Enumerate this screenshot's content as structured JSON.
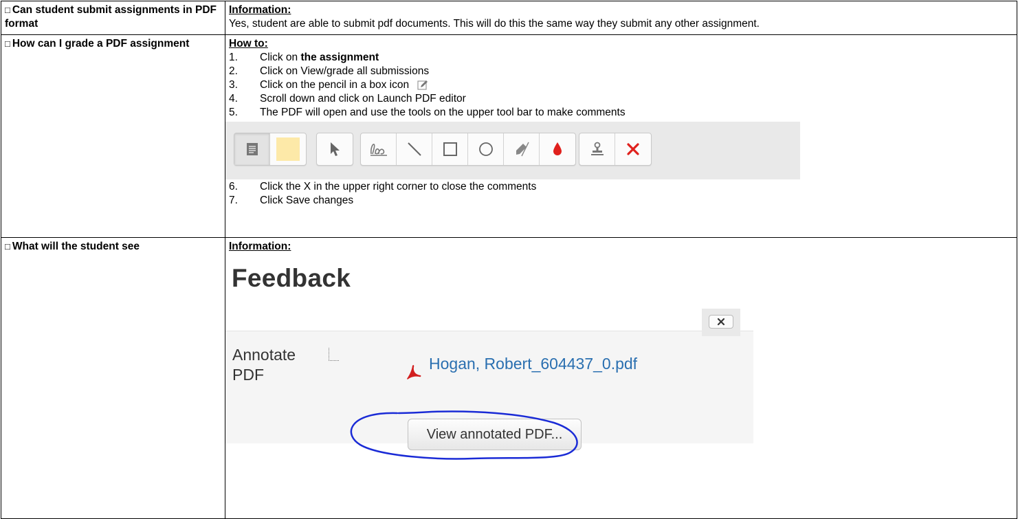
{
  "rows": [
    {
      "question": "Can student submit assignments in PDF format",
      "heading": "Information:",
      "body": "Yes, student are able to submit pdf documents. This will do this the same way they submit any other assignment."
    },
    {
      "question": "How can I grade a PDF assignment",
      "heading": "How to:",
      "steps": [
        {
          "num": "1.",
          "pre": "Click on ",
          "bold": "the assignment"
        },
        {
          "num": "2.",
          "text": "Click on View/grade all submissions"
        },
        {
          "num": "3.",
          "text": "Click on the pencil in a box icon",
          "icon": "pencil-box-icon"
        },
        {
          "num": "4.",
          "text": "Scroll down and click on Launch PDF editor"
        },
        {
          "num": "5.",
          "text": "The PDF will open and use the tools on the upper tool bar to make comments"
        },
        {
          "num": "6.",
          "text": "Click the X in the upper right corner to close the comments"
        },
        {
          "num": "7.",
          "text": "Click Save changes"
        }
      ],
      "toolbar_icons": [
        "comment-icon",
        "color-swatch-icon",
        "select-arrow-icon",
        "pen-icon",
        "line-icon",
        "rectangle-icon",
        "oval-icon",
        "highlighter-icon",
        "color-drop-icon",
        "stamp-icon",
        "delete-x-icon"
      ]
    },
    {
      "question": "What will the student see",
      "heading": "Information:",
      "feedback": {
        "title": "Feedback",
        "annotate_label": "Annotate PDF",
        "file_link": "Hogan, Robert_604437_0.pdf",
        "view_button": "View annotated PDF..."
      }
    }
  ],
  "checkbox_glyph": "□",
  "colors": {
    "link": "#2a6fb0",
    "swatch": "#fde9a8",
    "delete": "#e0211d",
    "drop": "#e0211d",
    "annotation_loop": "#1a2bd6",
    "pdf_icon": "#d21f1f"
  }
}
